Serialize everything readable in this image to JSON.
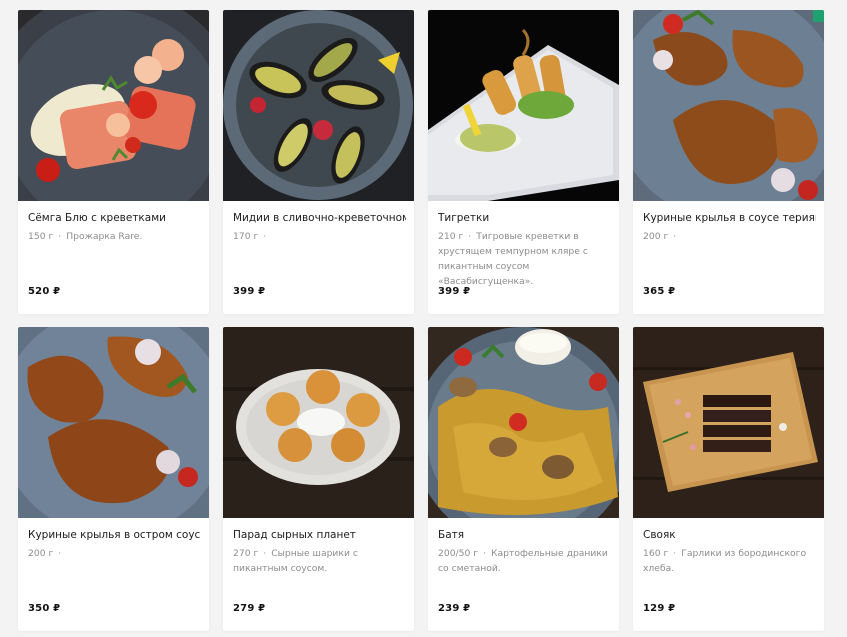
{
  "items": [
    {
      "name": "Сёмга Блю с креветками",
      "weight": "150 г",
      "desc": "Прожарка Rare.",
      "price": "520 ₽"
    },
    {
      "name": "Мидии в сливочно-креветочном",
      "weight": "170 г",
      "desc": "",
      "price": "399 ₽"
    },
    {
      "name": "Тигретки",
      "weight": "210 г",
      "desc": "Тигровые креветки в хрустящем темпурном кляре с пикантным соусом «Васабисгущенка».",
      "price": "399 ₽"
    },
    {
      "name": "Куриные крылья в соусе терияки",
      "weight": "200 г",
      "desc": "",
      "price": "365 ₽"
    },
    {
      "name": "Куриные крылья в остром соусе",
      "weight": "200 г",
      "desc": "",
      "price": "350 ₽"
    },
    {
      "name": "Парад сырных планет",
      "weight": "270 г",
      "desc": "Сырные шарики с пикантным соусом.",
      "price": "279 ₽"
    },
    {
      "name": "Батя",
      "weight": "200/50 г",
      "desc": "Картофельные драники со сметаной.",
      "price": "239 ₽"
    },
    {
      "name": "Свояк",
      "weight": "160 г",
      "desc": "Гарлики из бородинского хлеба.",
      "price": "129 ₽"
    }
  ],
  "separator": "·"
}
